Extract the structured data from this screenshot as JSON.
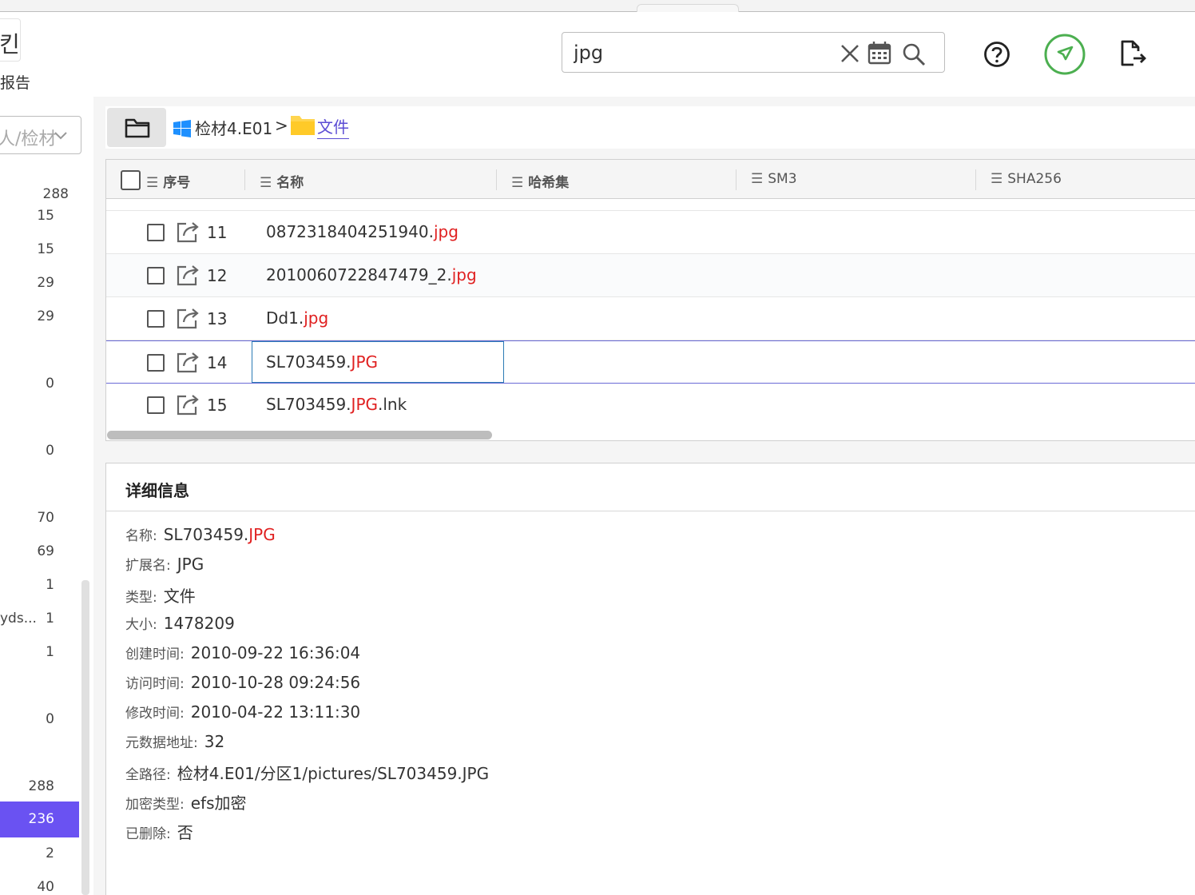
{
  "header": {
    "report_glyph": "킨",
    "report_label": "报告",
    "search": {
      "value": "jpg",
      "placeholder": ""
    },
    "icons": [
      "clear-icon",
      "calendar-icon",
      "search-icon",
      "help-icon",
      "rocket-icon",
      "export-icon"
    ]
  },
  "left": {
    "select_text": "人/检材",
    "values": [
      "288",
      "15",
      "15",
      "29",
      "29",
      "0",
      "0",
      "70",
      "69",
      "1",
      "1",
      "1",
      "0",
      "288",
      "236",
      "2",
      "40"
    ],
    "label_truncated": "yds...",
    "selected_value": "236"
  },
  "breadcrumb": {
    "root": "检材4.E01",
    "separator": ">",
    "folder": "文件"
  },
  "table": {
    "columns": [
      "序号",
      "名称",
      "哈希集",
      "SM3",
      "SHA256"
    ],
    "rows": [
      {
        "idx": "11",
        "base": "0872318404251940.",
        "ext": "jpg",
        "suffix": ""
      },
      {
        "idx": "12",
        "base": "2010060722847479_2.",
        "ext": "jpg",
        "suffix": ""
      },
      {
        "idx": "13",
        "base": "Dd1.",
        "ext": "jpg",
        "suffix": ""
      },
      {
        "idx": "14",
        "base": "SL703459.",
        "ext": "JPG",
        "suffix": ""
      },
      {
        "idx": "15",
        "base": "SL703459.",
        "ext": "JPG",
        "suffix": ".lnk"
      }
    ],
    "selected_row_idx": "14"
  },
  "detail": {
    "title": "详细信息",
    "name_label": "名称:",
    "name_base": "SL703459.",
    "name_ext": "JPG",
    "fields": [
      {
        "label": "扩展名:",
        "value": "JPG"
      },
      {
        "label": "类型:",
        "value": "文件"
      },
      {
        "label": "大小:",
        "value": "1478209"
      },
      {
        "label": "创建时间:",
        "value": "2010-09-22 16:36:04"
      },
      {
        "label": "访问时间:",
        "value": "2010-10-28 09:24:56"
      },
      {
        "label": "修改时间:",
        "value": "2010-04-22 13:11:30"
      },
      {
        "label": "元数据地址:",
        "value": "32"
      },
      {
        "label": "全路径:",
        "value": "检材4.E01/分区1/pictures/SL703459.JPG"
      },
      {
        "label": "加密类型:",
        "value": "efs加密"
      },
      {
        "label": "已删除:",
        "value": "否"
      }
    ]
  },
  "colors": {
    "accent": "#6a52f2",
    "highlight_ext": "#e02020",
    "rocket_ring": "#4caf50",
    "link": "#5b4cd4"
  }
}
